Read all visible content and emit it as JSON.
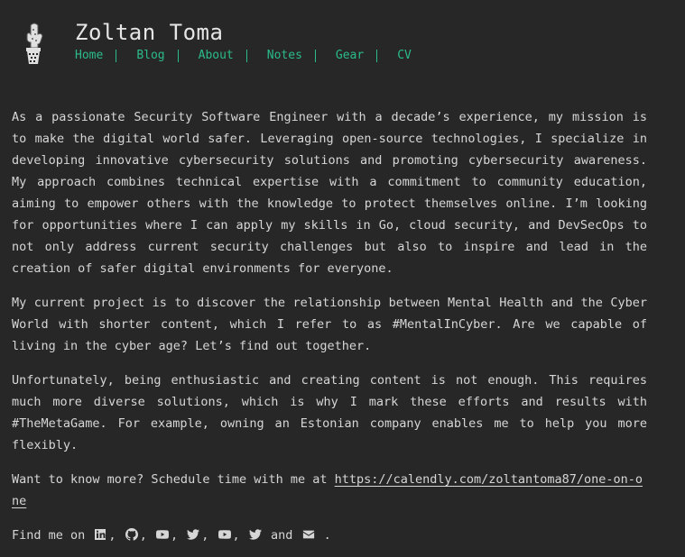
{
  "site": {
    "title": "Zoltan Toma"
  },
  "nav": [
    "Home",
    "Blog",
    "About",
    "Notes",
    "Gear",
    "CV"
  ],
  "paragraphs": [
    "As a passionate Security Software Engineer with a decade’s experience, my mission is to make the digital world safer. Leveraging open-source technologies, I specialize in developing innovative cybersecurity solutions and promoting cybersecurity awareness. My approach combines technical expertise with a commitment to community education, aiming to empower others with the knowledge to protect themselves online. I’m looking for opportunities where I can apply my skills in Go, cloud security, and DevSecOps to not only address current security challenges but also to inspire and lead in the creation of safer digital environments for everyone.",
    "My current project is to discover the relationship between Mental Health and the Cyber World with shorter content, which I refer to as #MentalInCyber. Are we capable of living in the cyber age? Let’s find out together.",
    "Unfortunately, being enthusiastic and creating content is not enough. This requires much more diverse solutions, which is why I mark these efforts and results with #TheMetaGame. For example, owning an Estonian company enables me to help you more flexibly."
  ],
  "schedule": {
    "text": "Want to know more? Schedule time with me at ",
    "link": "https://calendly.com/zoltantoma87/one-on-one"
  },
  "social": {
    "prefix": "Find me on",
    "sep": ",",
    "and": "and",
    "end": ".",
    "icons": [
      "linkedin-icon",
      "github-icon",
      "youtube-icon",
      "twitter-icon",
      "youtube-icon",
      "twitter-icon",
      "envelope-icon"
    ]
  },
  "colors": {
    "background": "#272727",
    "text": "#d6d6d6",
    "accent": "#2bbc8a"
  }
}
